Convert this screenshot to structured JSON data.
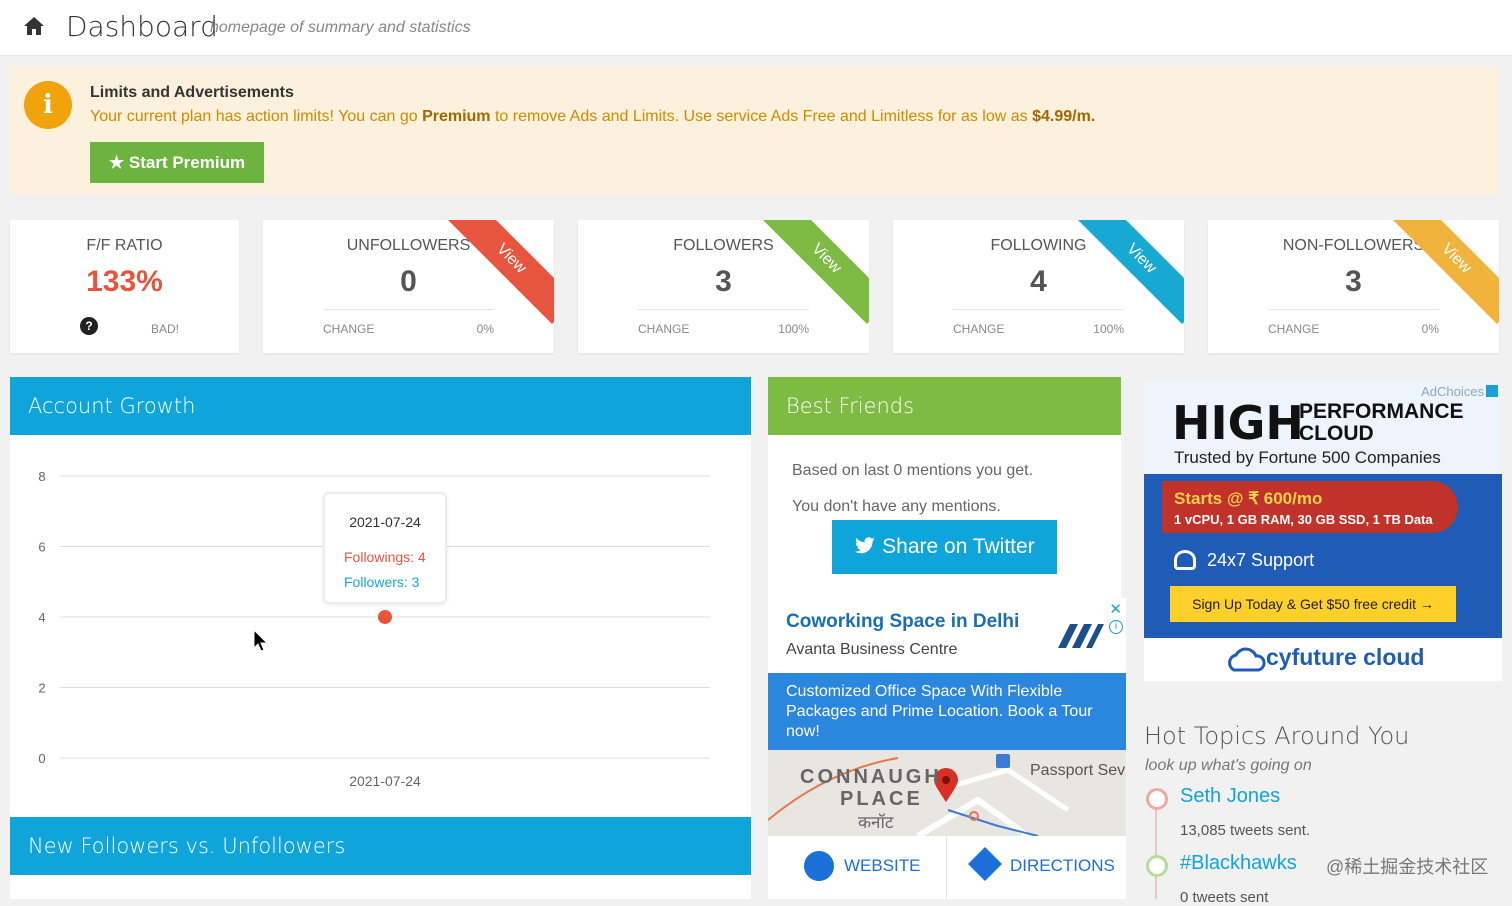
{
  "header": {
    "title": "Dashboard",
    "subtitle": "homepage of summary and statistics"
  },
  "alert": {
    "title": "Limits and Advertisements",
    "text_1": "Your current plan has action limits! You can go ",
    "premium": "Premium",
    "text_2": " to remove Ads and Limits. Use service Ads Free and Limitless for as low as ",
    "price": "$4.99/m.",
    "button": "Start Premium"
  },
  "cards": [
    {
      "label": "F/F RATIO",
      "value": "133%",
      "foot_left": "",
      "foot_right": "BAD!",
      "ribbon": ""
    },
    {
      "label": "UNFOLLOWERS",
      "value": "0",
      "foot_left": "CHANGE",
      "foot_right": "0%",
      "ribbon": "View",
      "ribbon_color": "#e8553e"
    },
    {
      "label": "FOLLOWERS",
      "value": "3",
      "foot_left": "CHANGE",
      "foot_right": "100%",
      "ribbon": "View",
      "ribbon_color": "#7dbb42"
    },
    {
      "label": "FOLLOWING",
      "value": "4",
      "foot_left": "CHANGE",
      "foot_right": "100%",
      "ribbon": "View",
      "ribbon_color": "#17a9d1"
    },
    {
      "label": "NON-FOLLOWERS",
      "value": "3",
      "foot_left": "CHANGE",
      "foot_right": "0%",
      "ribbon": "View",
      "ribbon_color": "#f0b43c"
    }
  ],
  "colors": {
    "ratio": "#e8553e",
    "blue": "#0fa5db",
    "green": "#7dbb42"
  },
  "account_growth": {
    "title": "Account Growth"
  },
  "chart_data": {
    "type": "line",
    "x": [
      "2021-07-24"
    ],
    "series": [
      {
        "name": "Followings",
        "values": [
          4
        ],
        "color": "#e8553e"
      },
      {
        "name": "Followers",
        "values": [
          3
        ],
        "color": "#17a9d1"
      }
    ],
    "yticks": [
      0,
      2,
      4,
      6,
      8
    ],
    "ylim": [
      0,
      8
    ],
    "grid": true,
    "tooltip": {
      "date": "2021-07-24",
      "line1": "Followings: 4",
      "line2": "Followers: 3"
    }
  },
  "new_followers": {
    "title": "New Followers vs. Unfollowers"
  },
  "best_friends": {
    "title": "Best Friends",
    "line1": "Based on last 0 mentions you get.",
    "line2": "You don't have any mentions.",
    "share": "Share on Twitter"
  },
  "ad1": {
    "title": "Coworking Space in Delhi",
    "subtitle": "Avanta Business Centre",
    "body": "Customized Office Space With Flexible Packages and Prime Location. Book a Tour now!",
    "map_1": "CONNAUGH",
    "map_2": "PLACE",
    "map_3": "कनॉट",
    "map_4": "Passport Sev",
    "website": "WEBSITE",
    "directions": "DIRECTIONS"
  },
  "ad2": {
    "adchoices": "AdChoices",
    "high": "HIGH",
    "performance": "PERFORMANCE",
    "cloud": "CLOUD",
    "trusted": "Trusted by Fortune 500 Companies",
    "starts": "Starts @ ₹ 600/mo",
    "specs": "1 vCPU, 1 GB RAM, 30 GB SSD, 1 TB Data",
    "support": "24x7 Support",
    "signup": "Sign Up Today & Get $50 free credit →",
    "brand": "cyfuture cloud"
  },
  "hot_topics": {
    "title": "Hot Topics Around You",
    "sub": "look up what's going on",
    "items": [
      {
        "name": "Seth Jones",
        "detail": "13,085 tweets sent."
      },
      {
        "name": "#Blackhawks",
        "detail": "0 tweets sent"
      }
    ]
  },
  "watermark": "@稀土掘金技术社区"
}
